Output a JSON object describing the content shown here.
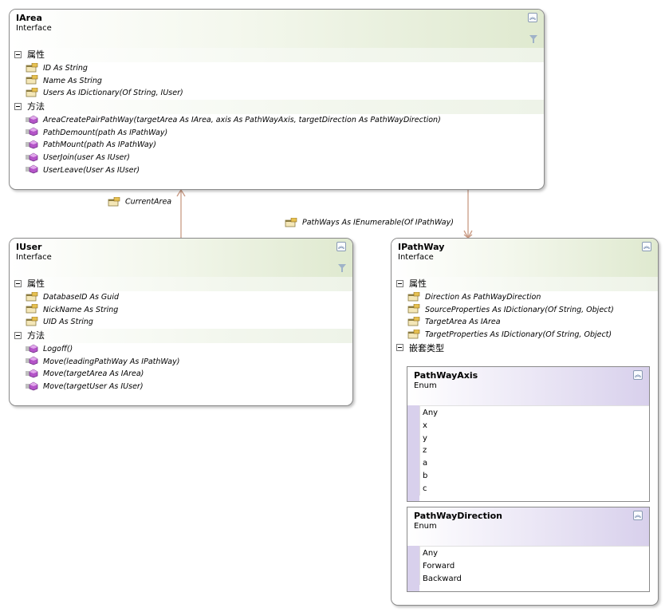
{
  "iarea": {
    "title": "IArea",
    "stereotype": "Interface",
    "properties_label": "属性",
    "properties": [
      "ID As String",
      "Name As String",
      "Users As IDictionary(Of String, IUser)"
    ],
    "methods_label": "方法",
    "methods": [
      "AreaCreatePairPathWay(targetArea As IArea, axis As PathWayAxis, targetDirection As PathWayDirection)",
      "PathDemount(path As IPathWay)",
      "PathMount(path As IPathWay)",
      "UserJoin(user As IUser)",
      "UserLeave(User As IUser)"
    ]
  },
  "iuser": {
    "title": "IUser",
    "stereotype": "Interface",
    "properties_label": "属性",
    "properties": [
      "DatabaseID As Guid",
      "NickName As String",
      "UID As String"
    ],
    "methods_label": "方法",
    "methods": [
      "Logoff()",
      "Move(leadingPathWay As IPathWay)",
      "Move(targetArea As IArea)",
      "Move(targetUser As IUser)"
    ]
  },
  "ipathway": {
    "title": "IPathWay",
    "stereotype": "Interface",
    "properties_label": "属性",
    "properties": [
      "Direction As PathWayDirection",
      "SourceProperties As IDictionary(Of String, Object)",
      "TargetArea As IArea",
      "TargetProperties As IDictionary(Of String, Object)"
    ],
    "nested_label": "嵌套类型"
  },
  "pathway_axis": {
    "title": "PathWayAxis",
    "stereotype": "Enum",
    "values": [
      "Any",
      "x",
      "y",
      "z",
      "a",
      "b",
      "c"
    ]
  },
  "pathway_direction": {
    "title": "PathWayDirection",
    "stereotype": "Enum",
    "values": [
      "Any",
      "Forward",
      "Backward"
    ]
  },
  "associations": {
    "current_area": "CurrentArea",
    "pathways": "PathWays As IEnumerable(Of IPathWay)"
  },
  "colors": {
    "connector": "#c89a84",
    "interface_header": "#dfe9cf",
    "enum_header": "#d8d0ec",
    "method_icon": "#b455c8",
    "property_icon": "#c8a030"
  },
  "icons": {
    "property": "property-icon",
    "method": "method-icon",
    "collapse": "collapse-icon",
    "filter": "filter-icon"
  }
}
